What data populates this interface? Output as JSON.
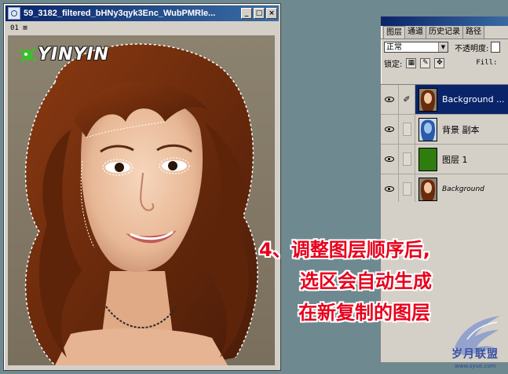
{
  "document_window": {
    "title": "59_3182_filtered_bHNy3qyk3Enc_WubPMRle...",
    "status": "01 ⊠",
    "buttons": {
      "minimize": "_",
      "restore": "□",
      "close": "×"
    },
    "logo_text": "YINYIN",
    "canvas_content": "portrait photo of a smiling young woman with auburn wavy hair; selection marquee (marching ants) traced around hair and eyes"
  },
  "layers_panel": {
    "tabs": [
      "图层",
      "通道",
      "历史记录",
      "路径"
    ],
    "blend_mode": "正常",
    "opacity_label": "不透明度:",
    "lock_label": "锁定:",
    "lock_icons": [
      "transparency-lock-icon",
      "paint-lock-icon",
      "move-lock-icon",
      "all-lock-icon"
    ],
    "fill_label": "Fill:",
    "layers": [
      {
        "name": "Background ...",
        "visible": true,
        "selected": true,
        "brush": true,
        "thumb": "woman-portrait"
      },
      {
        "name": "背景 副本",
        "visible": true,
        "selected": false,
        "brush": false,
        "thumb": "blue-negative-portrait"
      },
      {
        "name": "图层 1",
        "visible": true,
        "selected": false,
        "brush": false,
        "thumb": "green-fill"
      },
      {
        "name": "Background",
        "visible": true,
        "selected": false,
        "brush": false,
        "thumb": "woman-portrait",
        "italic": true
      }
    ]
  },
  "caption": {
    "line1": "4、调整图层顺序后,",
    "line2": "选区会自动生成",
    "line3": "在新复制的图层"
  },
  "watermark": {
    "text": "岁月联盟",
    "url": "www.syue.com"
  },
  "colors": {
    "desktop": "#6e8a90",
    "title_bar_start": "#0a246a",
    "title_bar_end": "#3a6ea5",
    "selected_layer": "#0a246a",
    "caption_red": "#e8001c",
    "layer1_green": "#2f7d0f"
  }
}
